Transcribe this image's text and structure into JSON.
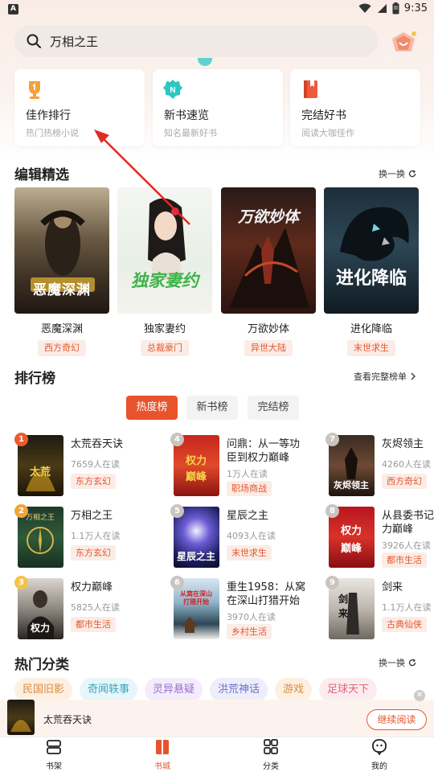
{
  "status": {
    "time": "9:35",
    "app_letter": "A"
  },
  "search": {
    "query": "万相之王"
  },
  "features": [
    {
      "title": "佳作排行",
      "sub": "热门热榜小说"
    },
    {
      "title": "新书速览",
      "sub": "知名最新好书"
    },
    {
      "title": "完结好书",
      "sub": "阅读大咖佳作"
    }
  ],
  "editor_picks": {
    "title": "编辑精选",
    "refresh": "换一换",
    "books": [
      {
        "title": "恶魔深渊",
        "tag": "西方奇幻",
        "cover_text": "恶魔深渊"
      },
      {
        "title": "独家妻约",
        "tag": "总裁豪门",
        "cover_text": "独家妻约"
      },
      {
        "title": "万欲妙体",
        "tag": "异世大陆",
        "cover_text": "万欲妙体"
      },
      {
        "title": "进化降临",
        "tag": "末世求生",
        "cover_text": "进化降临"
      }
    ]
  },
  "ranking": {
    "title": "排行榜",
    "view_all": "查看完整榜单",
    "tabs": [
      "热度榜",
      "新书榜",
      "完结榜"
    ],
    "items": [
      {
        "rank": "1",
        "title": "太荒吞天诀",
        "readers": "7659人在读",
        "tag": "东方玄幻"
      },
      {
        "rank": "2",
        "title": "万相之王",
        "readers": "1.1万人在读",
        "tag": "东方玄幻"
      },
      {
        "rank": "3",
        "title": "权力巅峰",
        "readers": "5825人在读",
        "tag": "都市生活"
      },
      {
        "rank": "4",
        "title": "问鼎：从一等功臣到权力巅峰",
        "readers": "1万人在读",
        "tag": "职场商战"
      },
      {
        "rank": "5",
        "title": "星辰之主",
        "readers": "4093人在读",
        "tag": "末世求生"
      },
      {
        "rank": "6",
        "title": "重生1958：从窝在深山打猎开始",
        "readers": "3970人在读",
        "tag": "乡村生活"
      },
      {
        "rank": "7",
        "title": "灰烬领主",
        "readers": "4260人在读",
        "tag": "西方奇幻"
      },
      {
        "rank": "8",
        "title": "从县委书记到权力巅峰",
        "readers": "3926人在读",
        "tag": "都市生活"
      },
      {
        "rank": "9",
        "title": "剑来",
        "readers": "1.1万人在读",
        "tag": "古典仙侠"
      }
    ]
  },
  "categories": {
    "title": "热门分类",
    "refresh": "换一换",
    "chips": [
      "民国旧影",
      "奇闻轶事",
      "灵异悬疑",
      "洪荒神话",
      "游戏",
      "足球天下"
    ]
  },
  "mini_player": {
    "title": "太荒吞天诀",
    "button": "继续阅读"
  },
  "nav": [
    {
      "label": "书架"
    },
    {
      "label": "书城"
    },
    {
      "label": "分类"
    },
    {
      "label": "我的"
    }
  ]
}
